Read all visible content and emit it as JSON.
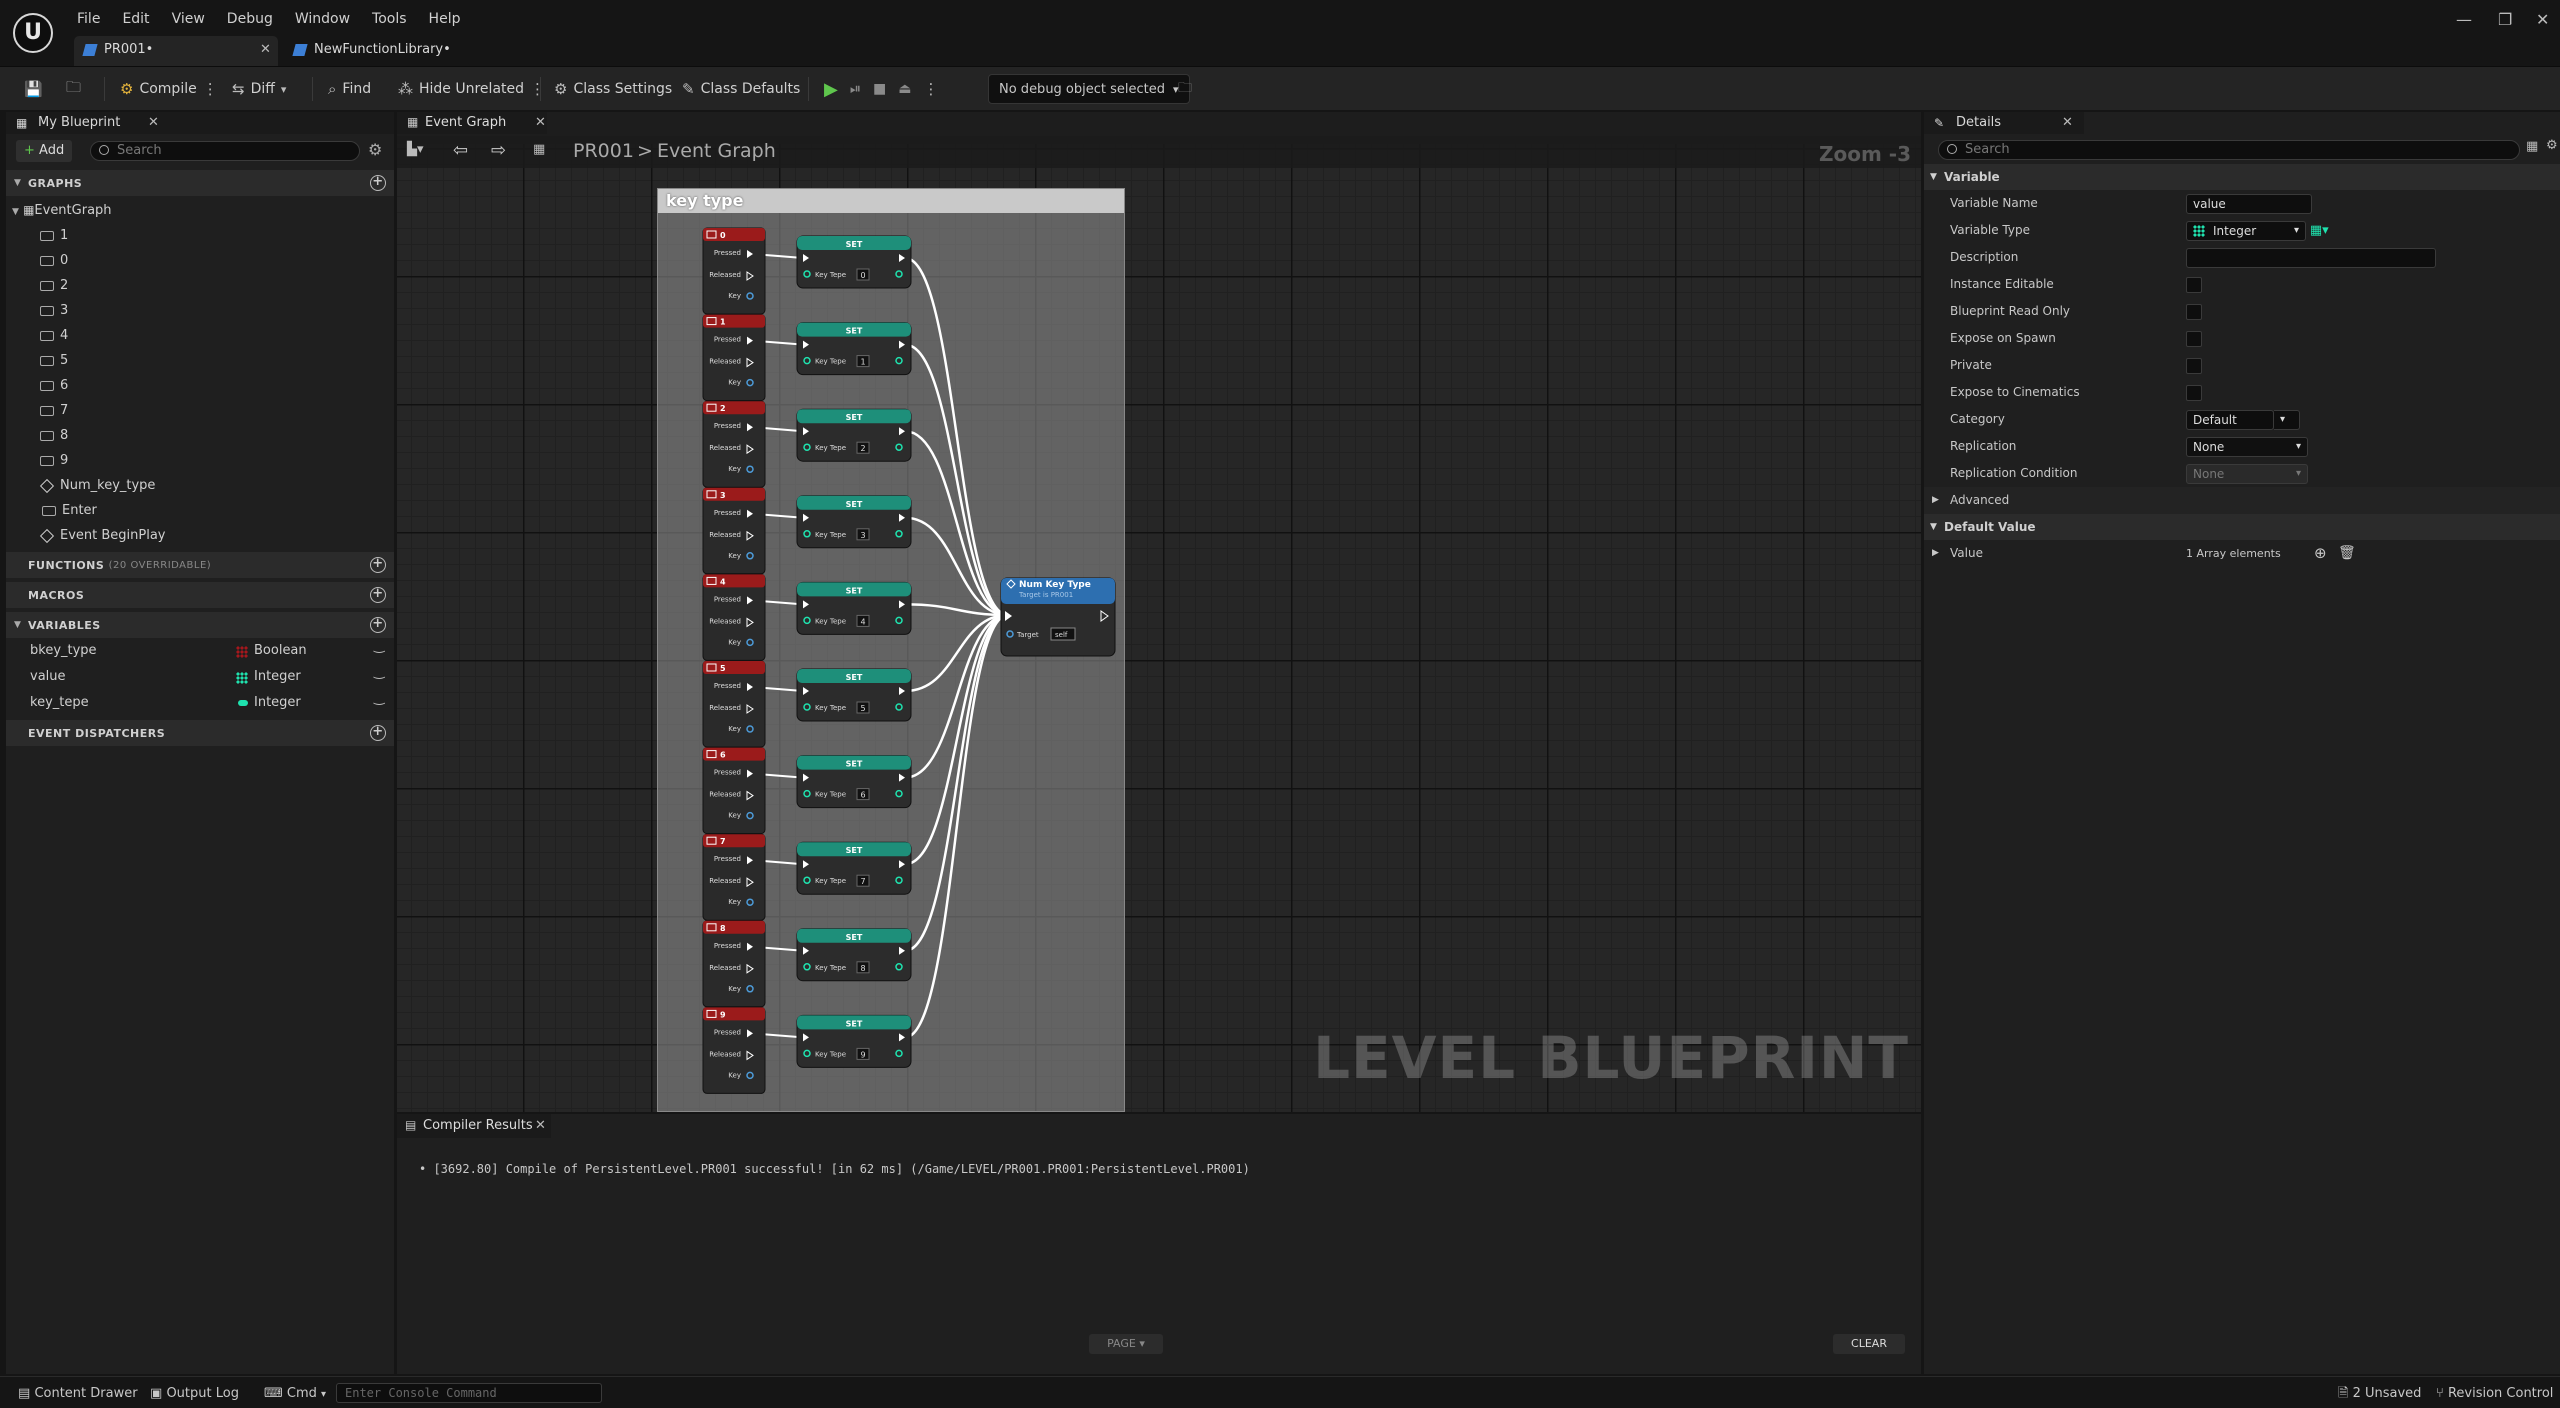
{
  "menu": [
    "File",
    "Edit",
    "View",
    "Debug",
    "Window",
    "Tools",
    "Help"
  ],
  "doc_tabs": [
    {
      "label": "PR001•",
      "active": true
    },
    {
      "label": "NewFunctionLibrary•",
      "active": false
    }
  ],
  "toolbar": {
    "compile": "Compile",
    "diff": "Diff",
    "find": "Find",
    "hide_unrelated": "Hide Unrelated",
    "class_settings": "Class Settings",
    "class_defaults": "Class Defaults",
    "debug_object": "No debug object selected"
  },
  "my_blueprint": {
    "tab": "My Blueprint",
    "add": "Add",
    "search_placeholder": "Search",
    "graphs_header": "GRAPHS",
    "event_graph": "EventGraph",
    "graph_items": [
      "1",
      "0",
      "2",
      "3",
      "4",
      "5",
      "6",
      "7",
      "8",
      "9"
    ],
    "event_items": [
      "Num_key_type",
      "Enter",
      "Event BeginPlay"
    ],
    "functions_header": "FUNCTIONS",
    "functions_note": "(20 OVERRIDABLE)",
    "macros_header": "MACROS",
    "variables_header": "VARIABLES",
    "variables": [
      {
        "name": "bkey_type",
        "type": "Boolean",
        "color": "#a6171c"
      },
      {
        "name": "value",
        "type": "Integer",
        "color": "#1fe3af"
      },
      {
        "name": "key_tepe",
        "type": "Integer",
        "color": "#1fe3af"
      }
    ],
    "dispatchers_header": "EVENT DISPATCHERS"
  },
  "graph": {
    "tab": "Event Graph",
    "breadcrumb_root": "PR001",
    "breadcrumb_sep": ">",
    "breadcrumb_leaf": "Event Graph",
    "zoom": "Zoom -3",
    "comment_title": "key type",
    "watermark": "LEVEL BLUEPRINT",
    "key_events": [
      "0",
      "1",
      "2",
      "3",
      "4",
      "5",
      "6",
      "7",
      "8",
      "9"
    ],
    "pin_pressed": "Pressed",
    "pin_released": "Released",
    "pin_key": "Key",
    "set_title": "SET",
    "set_pin": "Key Tepe",
    "func_title": "Num Key Type",
    "func_sub": "Target is PR001",
    "func_target": "Target",
    "func_self": "self"
  },
  "compiler": {
    "tab": "Compiler Results",
    "message": "[3692.80] Compile of PersistentLevel.PR001 successful! [in 62 ms] (/Game/LEVEL/PR001.PR001:PersistentLevel.PR001)",
    "page": "PAGE",
    "clear": "CLEAR"
  },
  "details": {
    "tab": "Details",
    "search_placeholder": "Search",
    "variable_section": "Variable",
    "rows": {
      "variable_name": "Variable Name",
      "variable_name_value": "value",
      "variable_type": "Variable Type",
      "variable_type_value": "Integer",
      "description": "Description",
      "instance_editable": "Instance Editable",
      "blueprint_read_only": "Blueprint Read Only",
      "expose_on_spawn": "Expose on Spawn",
      "private": "Private",
      "expose_to_cinematics": "Expose to Cinematics",
      "category": "Category",
      "category_value": "Default",
      "replication": "Replication",
      "replication_value": "None",
      "replication_condition": "Replication Condition",
      "replication_condition_value": "None"
    },
    "advanced": "Advanced",
    "default_value_section": "Default Value",
    "value_label": "Value",
    "value_text": "1 Array elements"
  },
  "statusbar": {
    "content_drawer": "Content Drawer",
    "output_log": "Output Log",
    "cmd": "Cmd",
    "console_placeholder": "Enter Console Command",
    "unsaved": "2 Unsaved",
    "revision": "Revision Control"
  },
  "colors": {
    "event_red": "#9b1b1b",
    "set_teal": "#1e8f7a",
    "int_pin": "#1fe3af",
    "bool_pin": "#a6171c",
    "func_blue": "#2d6fb0"
  }
}
